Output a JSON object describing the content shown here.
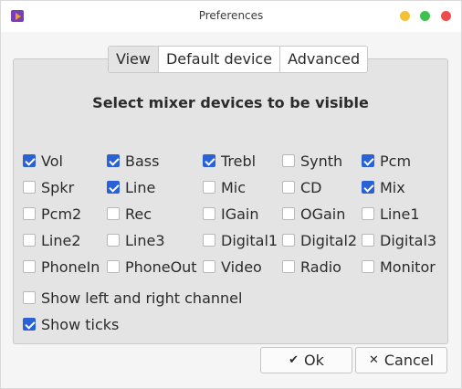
{
  "window": {
    "title": "Preferences"
  },
  "tabs": [
    {
      "label": "View",
      "active": true
    },
    {
      "label": "Default device",
      "active": false
    },
    {
      "label": "Advanced",
      "active": false
    }
  ],
  "heading": "Select mixer devices to be visible",
  "devices": [
    {
      "label": "Vol",
      "checked": true
    },
    {
      "label": "Bass",
      "checked": true
    },
    {
      "label": "Trebl",
      "checked": true
    },
    {
      "label": "Synth",
      "checked": false
    },
    {
      "label": "Pcm",
      "checked": true
    },
    {
      "label": "Spkr",
      "checked": false
    },
    {
      "label": "Line",
      "checked": true
    },
    {
      "label": "Mic",
      "checked": false
    },
    {
      "label": "CD",
      "checked": false
    },
    {
      "label": "Mix",
      "checked": true
    },
    {
      "label": "Pcm2",
      "checked": false
    },
    {
      "label": "Rec",
      "checked": false
    },
    {
      "label": "IGain",
      "checked": false
    },
    {
      "label": "OGain",
      "checked": false
    },
    {
      "label": "Line1",
      "checked": false
    },
    {
      "label": "Line2",
      "checked": false
    },
    {
      "label": "Line3",
      "checked": false
    },
    {
      "label": "Digital1",
      "checked": false
    },
    {
      "label": "Digital2",
      "checked": false
    },
    {
      "label": "Digital3",
      "checked": false
    },
    {
      "label": "PhoneIn",
      "checked": false
    },
    {
      "label": "PhoneOut",
      "checked": false
    },
    {
      "label": "Video",
      "checked": false
    },
    {
      "label": "Radio",
      "checked": false
    },
    {
      "label": "Monitor",
      "checked": false
    }
  ],
  "options": [
    {
      "label": "Show left and right channel",
      "checked": false
    },
    {
      "label": "Show ticks",
      "checked": true
    }
  ],
  "buttons": {
    "ok": {
      "label": "Ok",
      "icon": "checkmark-icon"
    },
    "cancel": {
      "label": "Cancel",
      "icon": "x-icon"
    }
  },
  "colors": {
    "accent": "#2a62d6",
    "close": "#ee4b4b",
    "minimize": "#f2c136",
    "maximize": "#3fc14f"
  }
}
